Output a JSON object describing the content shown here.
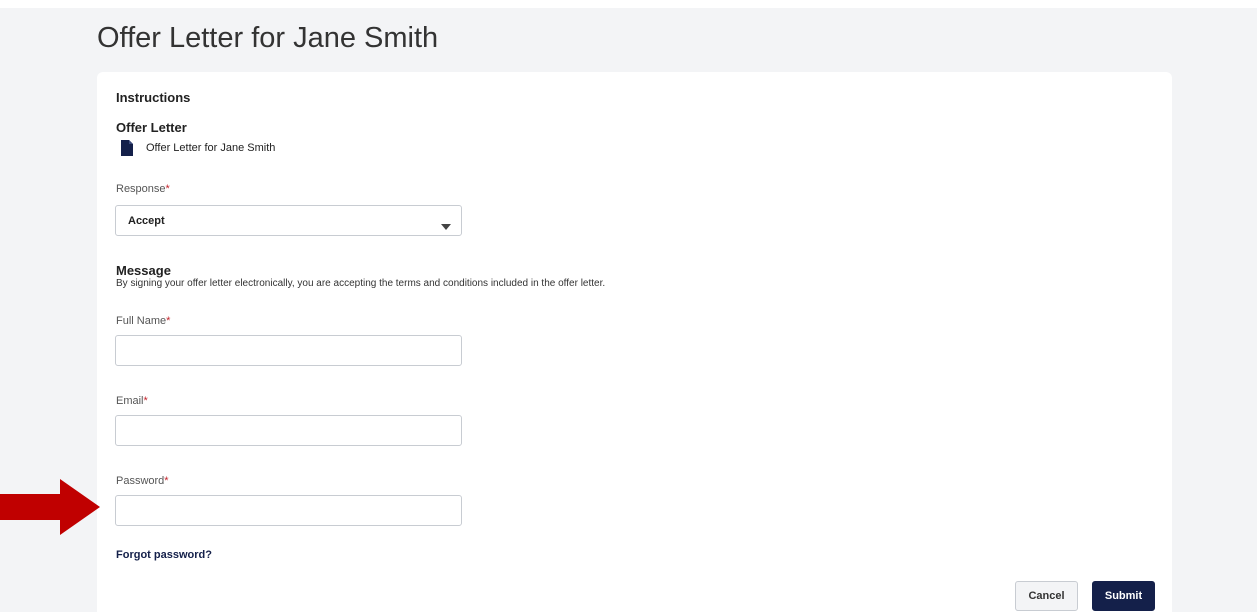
{
  "page": {
    "title": "Offer Letter for Jane Smith"
  },
  "card": {
    "instructions_heading": "Instructions",
    "offer_letter_heading": "Offer Letter",
    "offer_file": {
      "icon": "document-icon",
      "name": "Offer Letter for Jane Smith"
    }
  },
  "form": {
    "response": {
      "label": "Response",
      "required_mark": "*",
      "selected": "Accept"
    },
    "message": {
      "title": "Message",
      "text": "By signing your offer letter electronically, you are accepting the terms and conditions included in the offer letter."
    },
    "full_name": {
      "label": "Full Name",
      "required_mark": "*",
      "value": ""
    },
    "email": {
      "label": "Email",
      "required_mark": "*",
      "value": ""
    },
    "password": {
      "label": "Password",
      "required_mark": "*",
      "value": ""
    },
    "forgot_password": "Forgot password?"
  },
  "actions": {
    "cancel": "Cancel",
    "submit": "Submit"
  },
  "colors": {
    "primary": "#14204a",
    "required": "#c4262e",
    "annotation_arrow": "#c00000",
    "background": "#f3f4f6"
  }
}
